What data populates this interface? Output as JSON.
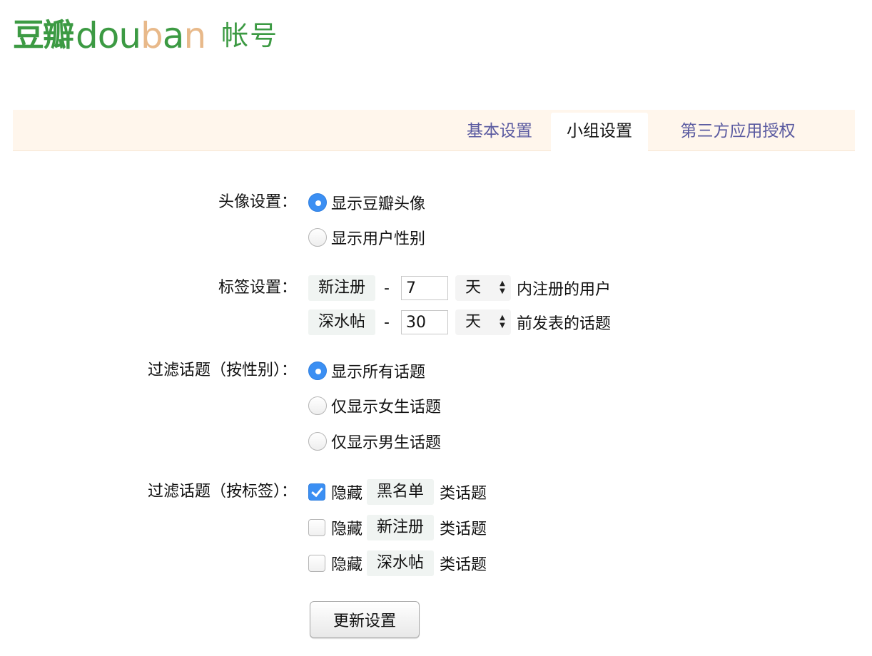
{
  "logo": {
    "cn": "豆瓣",
    "en_parts": [
      {
        "text": "d",
        "color": "green"
      },
      {
        "text": "o",
        "color": "green"
      },
      {
        "text": "u",
        "color": "green"
      },
      {
        "text": "b",
        "color": "orange"
      },
      {
        "text": "a",
        "color": "green"
      },
      {
        "text": "n",
        "color": "orange"
      }
    ],
    "en": "douban",
    "account": "帐号"
  },
  "tabs": [
    {
      "label": "基本设置",
      "active": false
    },
    {
      "label": "小组设置",
      "active": true
    },
    {
      "label": "第三方应用授权",
      "active": false
    }
  ],
  "avatar": {
    "label": "头像设置：",
    "options": [
      {
        "label": "显示豆瓣头像",
        "checked": true
      },
      {
        "label": "显示用户性别",
        "checked": false
      }
    ]
  },
  "tags": {
    "label": "标签设置：",
    "rows": [
      {
        "tag": "新注册",
        "dash": "-",
        "value": "7",
        "unit": "天",
        "suffix": "内注册的用户"
      },
      {
        "tag": "深水帖",
        "dash": "-",
        "value": "30",
        "unit": "天",
        "suffix": "前发表的话题"
      }
    ]
  },
  "filter_gender": {
    "label": "过滤话题（按性别）：",
    "options": [
      {
        "label": "显示所有话题",
        "checked": true
      },
      {
        "label": "仅显示女生话题",
        "checked": false
      },
      {
        "label": "仅显示男生话题",
        "checked": false
      }
    ]
  },
  "filter_tag": {
    "label": "过滤话题（按标签）：",
    "options": [
      {
        "hide": "隐藏",
        "tag": "黑名单",
        "suffix": "类话题",
        "checked": true
      },
      {
        "hide": "隐藏",
        "tag": "新注册",
        "suffix": "类话题",
        "checked": false
      },
      {
        "hide": "隐藏",
        "tag": "深水帖",
        "suffix": "类话题",
        "checked": false
      }
    ]
  },
  "submit_label": "更新设置",
  "colors": {
    "brand_green": "#3c9a43",
    "brand_orange": "#e8b98a",
    "tab_bar_bg": "#fff6ec",
    "tab_link": "#5a5aa0",
    "control_blue": "#3b8ff3"
  }
}
